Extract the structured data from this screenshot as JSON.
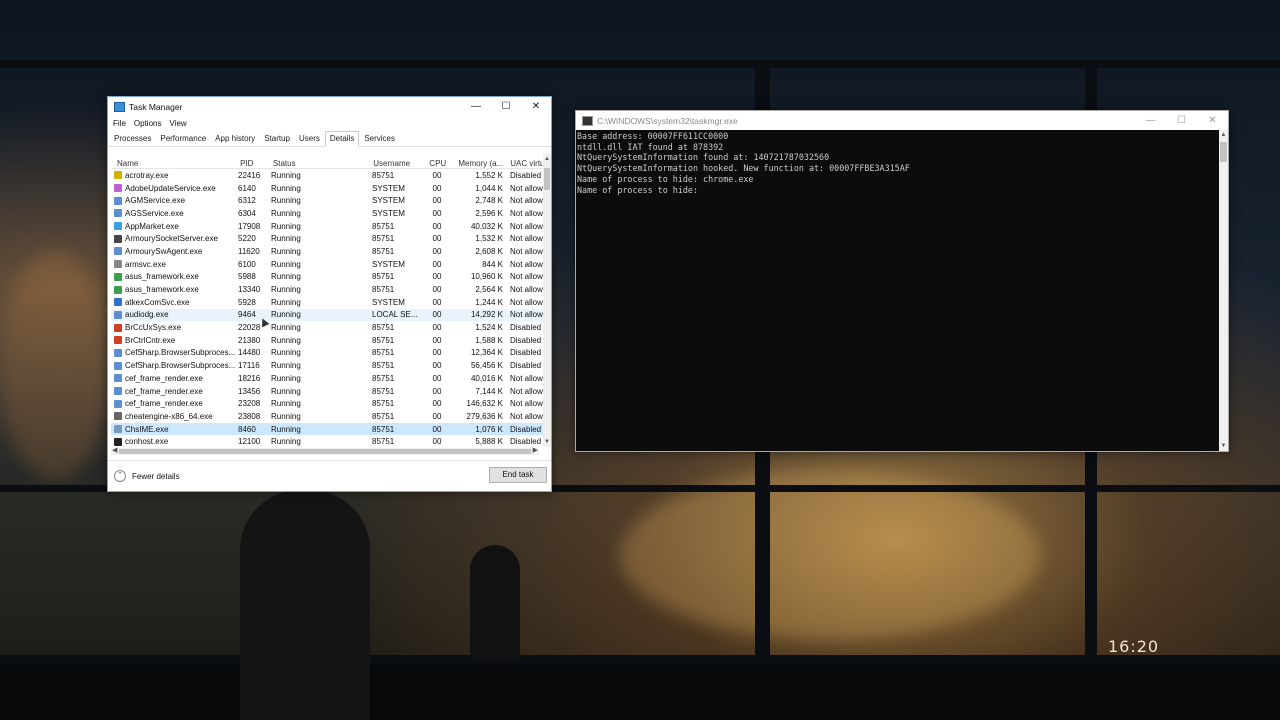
{
  "desktop": {
    "clock": "16:20"
  },
  "task_manager": {
    "title": "Task Manager",
    "menu": [
      "File",
      "Options",
      "View"
    ],
    "tabs": [
      "Processes",
      "Performance",
      "App history",
      "Startup",
      "Users",
      "Details",
      "Services"
    ],
    "active_tab": "Details",
    "columns": {
      "name": "Name",
      "pid": "PID",
      "status": "Status",
      "username": "Username",
      "cpu": "CPU",
      "memory": "Memory (a...",
      "uac": "UAC virtu"
    },
    "rows": [
      {
        "name": "acrotray.exe",
        "pid": "22416",
        "status": "Running",
        "user": "85751",
        "cpu": "00",
        "mem": "1,552 K",
        "uac": "Disabled",
        "icon": "#d4b000"
      },
      {
        "name": "AdobeUpdateService.exe",
        "pid": "6140",
        "status": "Running",
        "user": "SYSTEM",
        "cpu": "00",
        "mem": "1,044 K",
        "uac": "Not allowed",
        "icon": "#c060d0"
      },
      {
        "name": "AGMService.exe",
        "pid": "6312",
        "status": "Running",
        "user": "SYSTEM",
        "cpu": "00",
        "mem": "2,748 K",
        "uac": "Not allowed",
        "icon": "#5a8fd0"
      },
      {
        "name": "AGSService.exe",
        "pid": "6304",
        "status": "Running",
        "user": "SYSTEM",
        "cpu": "00",
        "mem": "2,596 K",
        "uac": "Not allowed",
        "icon": "#5a8fd0"
      },
      {
        "name": "AppMarket.exe",
        "pid": "17908",
        "status": "Running",
        "user": "85751",
        "cpu": "00",
        "mem": "40,032 K",
        "uac": "Not allowed",
        "icon": "#3aa0e0"
      },
      {
        "name": "ArmourySocketServer.exe",
        "pid": "5220",
        "status": "Running",
        "user": "85751",
        "cpu": "00",
        "mem": "1,532 K",
        "uac": "Not allowed",
        "icon": "#444444"
      },
      {
        "name": "ArmourySwAgent.exe",
        "pid": "11620",
        "status": "Running",
        "user": "85751",
        "cpu": "00",
        "mem": "2,608 K",
        "uac": "Not allowed",
        "icon": "#5a8fd0"
      },
      {
        "name": "armsvc.exe",
        "pid": "6100",
        "status": "Running",
        "user": "SYSTEM",
        "cpu": "00",
        "mem": "844 K",
        "uac": "Not allowed",
        "icon": "#888888"
      },
      {
        "name": "asus_framework.exe",
        "pid": "5988",
        "status": "Running",
        "user": "85751",
        "cpu": "00",
        "mem": "10,960 K",
        "uac": "Not allowed",
        "icon": "#3aa050"
      },
      {
        "name": "asus_framework.exe",
        "pid": "13340",
        "status": "Running",
        "user": "85751",
        "cpu": "00",
        "mem": "2,564 K",
        "uac": "Not allowed",
        "icon": "#3aa050"
      },
      {
        "name": "atkexComSvc.exe",
        "pid": "5928",
        "status": "Running",
        "user": "SYSTEM",
        "cpu": "00",
        "mem": "1,244 K",
        "uac": "Not allowed",
        "icon": "#2f6fd0"
      },
      {
        "name": "audiodg.exe",
        "pid": "9464",
        "status": "Running",
        "user": "LOCAL SE...",
        "cpu": "00",
        "mem": "14,292 K",
        "uac": "Not allowed",
        "icon": "#5a8fd0"
      },
      {
        "name": "BrCcUxSys.exe",
        "pid": "22028",
        "status": "Running",
        "user": "85751",
        "cpu": "00",
        "mem": "1,524 K",
        "uac": "Disabled",
        "icon": "#d04020"
      },
      {
        "name": "BrCtrlCntr.exe",
        "pid": "21380",
        "status": "Running",
        "user": "85751",
        "cpu": "00",
        "mem": "1,588 K",
        "uac": "Disabled",
        "icon": "#d04020"
      },
      {
        "name": "CefSharp.BrowserSubproces...",
        "pid": "14480",
        "status": "Running",
        "user": "85751",
        "cpu": "00",
        "mem": "12,364 K",
        "uac": "Disabled",
        "icon": "#5a8fd0"
      },
      {
        "name": "CefSharp.BrowserSubproces...",
        "pid": "17116",
        "status": "Running",
        "user": "85751",
        "cpu": "00",
        "mem": "56,456 K",
        "uac": "Disabled",
        "icon": "#5a8fd0"
      },
      {
        "name": "cef_frame_render.exe",
        "pid": "18216",
        "status": "Running",
        "user": "85751",
        "cpu": "00",
        "mem": "40,016 K",
        "uac": "Not allowed",
        "icon": "#5a8fd0"
      },
      {
        "name": "cef_frame_render.exe",
        "pid": "13456",
        "status": "Running",
        "user": "85751",
        "cpu": "00",
        "mem": "7,144 K",
        "uac": "Not allowed",
        "icon": "#5a8fd0"
      },
      {
        "name": "cef_frame_render.exe",
        "pid": "23208",
        "status": "Running",
        "user": "85751",
        "cpu": "00",
        "mem": "146,632 K",
        "uac": "Not allowed",
        "icon": "#5a8fd0"
      },
      {
        "name": "cheatengine-x86_64.exe",
        "pid": "23808",
        "status": "Running",
        "user": "85751",
        "cpu": "00",
        "mem": "279,636 K",
        "uac": "Not allowed",
        "icon": "#666666"
      },
      {
        "name": "ChsIME.exe",
        "pid": "8460",
        "status": "Running",
        "user": "85751",
        "cpu": "00",
        "mem": "1,076 K",
        "uac": "Disabled",
        "icon": "#7a9ac0"
      },
      {
        "name": "conhost.exe",
        "pid": "12100",
        "status": "Running",
        "user": "85751",
        "cpu": "00",
        "mem": "5,888 K",
        "uac": "Disabled",
        "icon": "#222222"
      }
    ],
    "selected_row": 20,
    "hover_row": 11,
    "fewer_details": "Fewer details",
    "end_task": "End task"
  },
  "console": {
    "title": "C:\\WINDOWS\\system32\\taskmgr.exe",
    "lines": [
      "Base address: 00007FF611CC0000",
      "ntdll.dll IAT found at 878392",
      "NtQuerySystemInformation found at: 140721787032560",
      "NtQuerySystemInformation hooked. New function at: 00007FFBE3A315AF",
      "Name of process to hide: chrome.exe",
      "Name of process to hide:"
    ]
  }
}
